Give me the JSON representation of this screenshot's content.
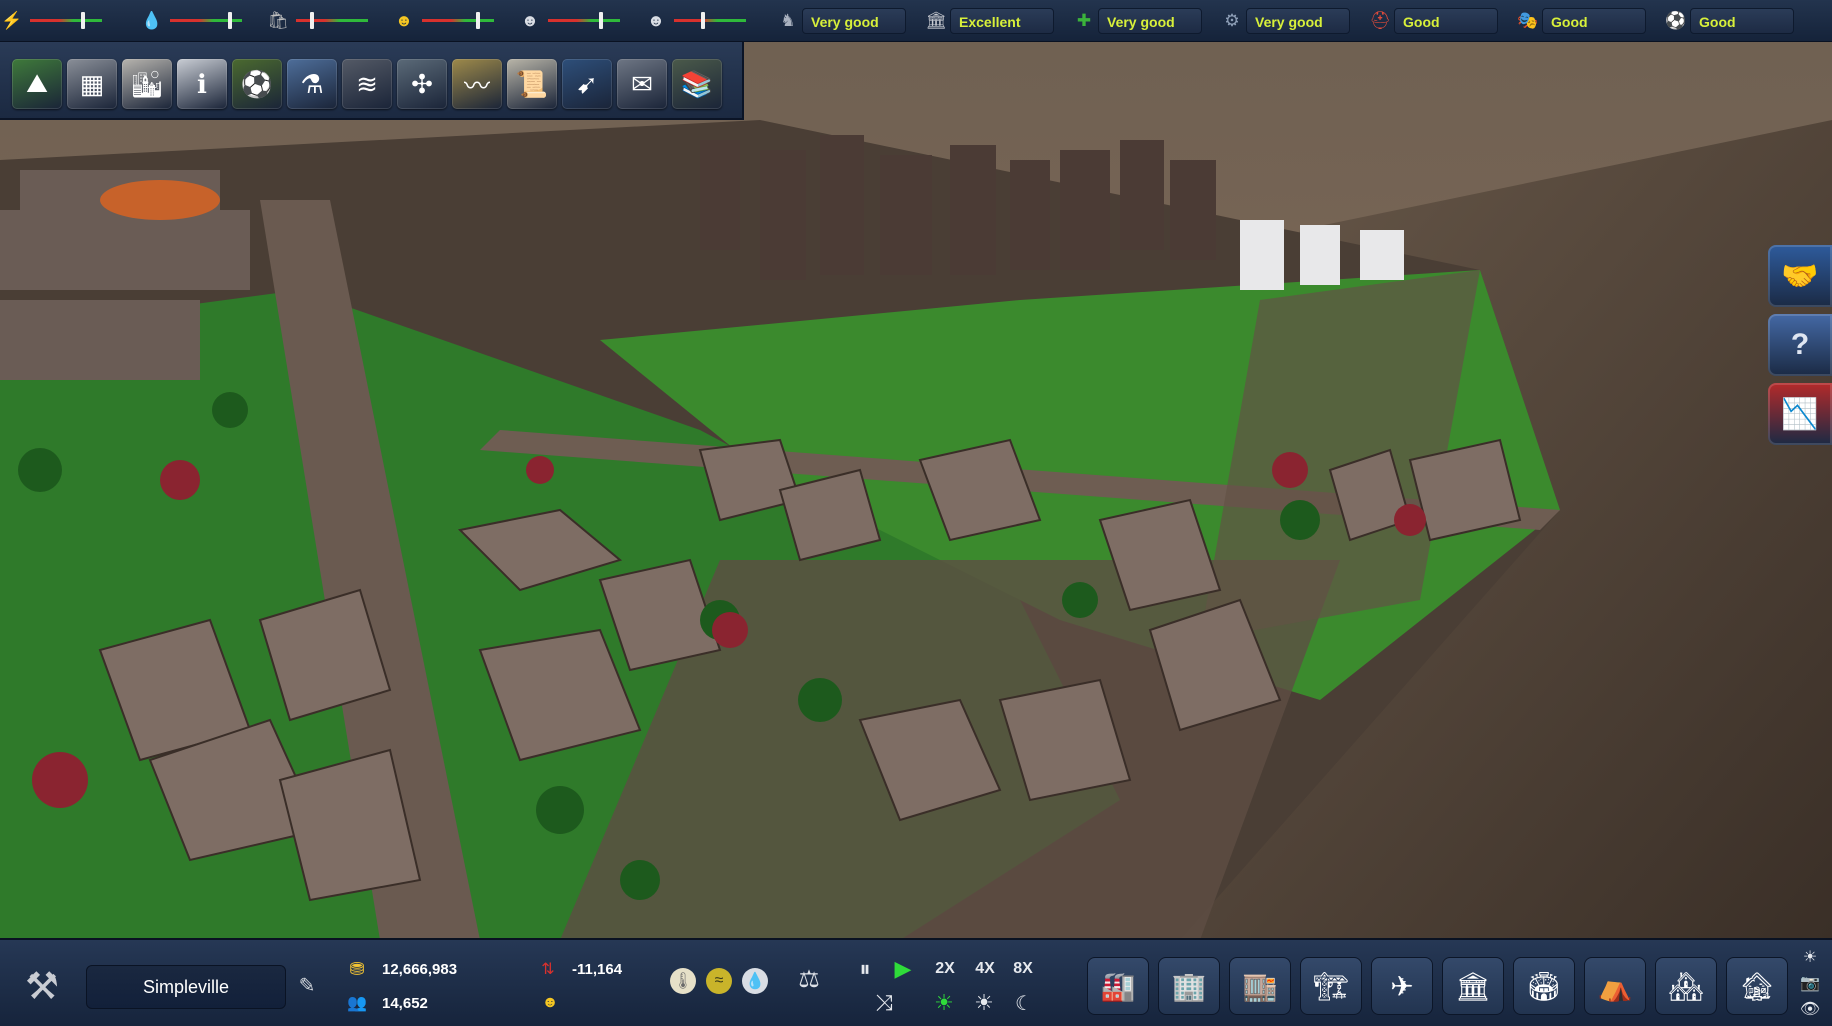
{
  "colors": {
    "accent": "#d8f03a",
    "red": "#d8312d",
    "green": "#2fb93b",
    "bar": "#1d2b44"
  },
  "meters": [
    {
      "icon": "lightning-icon",
      "glyph": "⚡",
      "level": 0.75
    },
    {
      "icon": "water-drop-icon",
      "glyph": "💧",
      "level": 0.85
    },
    {
      "icon": "waste-bag-icon",
      "glyph": "🛍",
      "level": 0.2
    },
    {
      "icon": "health-icon",
      "glyph": "☻",
      "level": 0.8
    },
    {
      "icon": "education-icon",
      "glyph": "☻",
      "level": 0.75
    },
    {
      "icon": "safety-icon",
      "glyph": "☻",
      "level": 0.4
    }
  ],
  "ratings": [
    {
      "icon": "happiness-icon",
      "glyph": "♞",
      "label": "Very good"
    },
    {
      "icon": "culture-icon",
      "glyph": "🏛",
      "label": "Excellent"
    },
    {
      "icon": "environment-icon",
      "glyph": "✚",
      "label": "Very good"
    },
    {
      "icon": "transport-icon",
      "glyph": "⚙",
      "label": "Very good"
    },
    {
      "icon": "fire-safety-icon",
      "glyph": "⛑",
      "label": "Good"
    },
    {
      "icon": "entertainment-icon",
      "glyph": "🎭",
      "label": "Good"
    },
    {
      "icon": "tourism-icon",
      "glyph": "⚽",
      "label": "Good"
    }
  ],
  "tools": [
    {
      "name": "terrain-tool",
      "glyph": "⛰",
      "color": "#3f7a3a"
    },
    {
      "name": "zoning-tool",
      "glyph": "▦",
      "color": "#8a8f98"
    },
    {
      "name": "city-overview-tool",
      "glyph": "🏙",
      "color": "#b7b4ae"
    },
    {
      "name": "info-tool",
      "glyph": "ℹ",
      "color": "#c9cdd4"
    },
    {
      "name": "sports-tool",
      "glyph": "⚽",
      "color": "#4b6a2f"
    },
    {
      "name": "research-tool",
      "glyph": "⚗",
      "color": "#4e6e9a"
    },
    {
      "name": "roads-tool",
      "glyph": "≋",
      "color": "#545a66"
    },
    {
      "name": "pipes-tool",
      "glyph": "✣",
      "color": "#5b6a78"
    },
    {
      "name": "graph-tool",
      "glyph": "〰",
      "color": "#9e8a4a"
    },
    {
      "name": "documents-tool",
      "glyph": "📜",
      "color": "#b9b5a8"
    },
    {
      "name": "transit-tool",
      "glyph": "➹",
      "color": "#2e4f7a"
    },
    {
      "name": "mail-tool",
      "glyph": "✉",
      "color": "#6e7684"
    },
    {
      "name": "library-tool",
      "glyph": "📚",
      "color": "#4b5a4a"
    }
  ],
  "side": [
    {
      "name": "trade-deal-button",
      "icon": "handshake-icon",
      "glyph": "🤝",
      "color": "#2e5b9c"
    },
    {
      "name": "help-button",
      "icon": "question-icon",
      "glyph": "?",
      "color": "#4469a5"
    },
    {
      "name": "economy-alert-button",
      "icon": "decline-chart-icon",
      "glyph": "📉",
      "color": "#b42a2a"
    }
  ],
  "bottom": {
    "city_name": "Simpleville",
    "money": "12,666,983",
    "population": "14,652",
    "balance": "-11,164",
    "speeds": [
      "2X",
      "4X",
      "8X"
    ],
    "buildings": [
      {
        "name": "utilities-building-button",
        "glyph": "🏭"
      },
      {
        "name": "residential-building-button",
        "glyph": "🏢"
      },
      {
        "name": "commercial-building-button",
        "glyph": "🏬"
      },
      {
        "name": "industrial-building-button",
        "glyph": "🏗"
      },
      {
        "name": "airport-building-button",
        "glyph": "✈"
      },
      {
        "name": "services-building-button",
        "glyph": "🏛"
      },
      {
        "name": "landmark-building-button",
        "glyph": "🏟"
      },
      {
        "name": "greenhouse-building-button",
        "glyph": "⛺"
      },
      {
        "name": "storage-building-button",
        "glyph": "🏘"
      },
      {
        "name": "demolish-building-button",
        "glyph": "🏚"
      }
    ]
  }
}
